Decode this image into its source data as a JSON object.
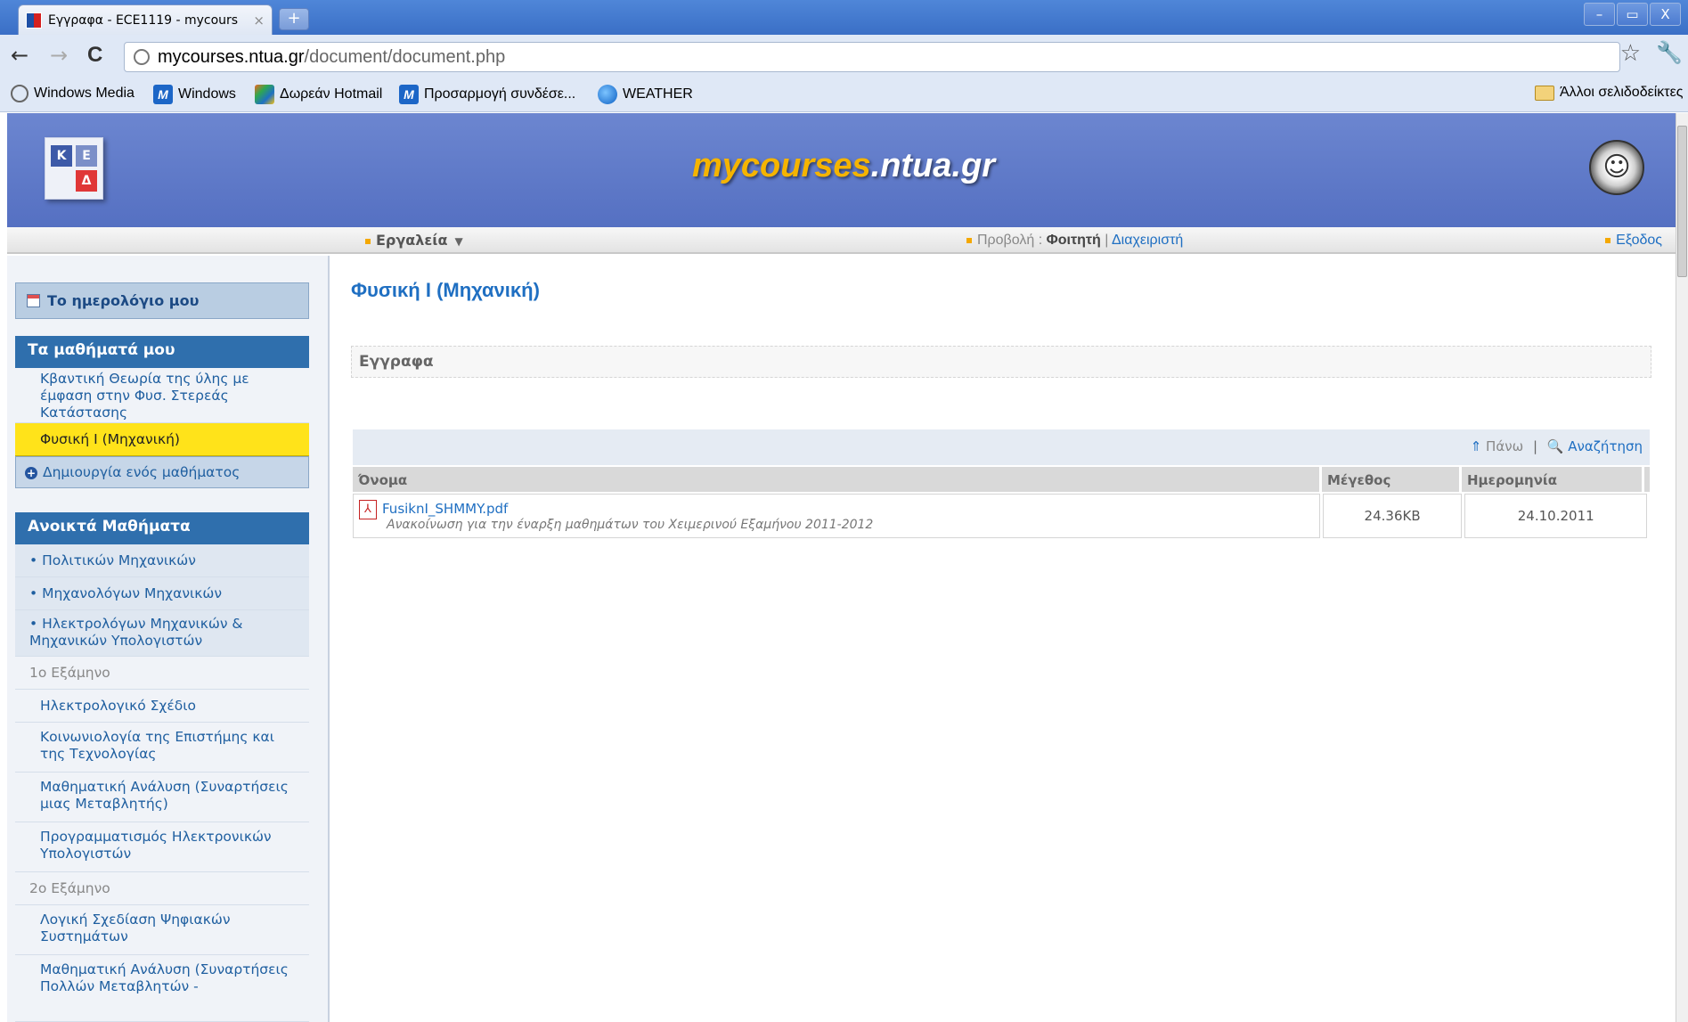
{
  "browser": {
    "tab_title": "Εγγραφα - ECE1119 - mycours",
    "tab_close": "×",
    "new_tab": "+",
    "url_host": "mycourses.ntua.gr",
    "url_path": "/document/document.php",
    "back": "←",
    "forward": "→",
    "reload": "C",
    "star": "☆",
    "wrench": "🔧",
    "window_controls": [
      "–",
      "▭",
      "X"
    ],
    "bookmarks": [
      "Windows Media",
      "Windows",
      "Δωρεάν Hotmail",
      "Προσαρμογή συνδέσε...",
      "WEATHER"
    ],
    "other_bookmarks": "Άλλοι σελιδοδείκτες"
  },
  "site": {
    "name_part1": "mycourses",
    "name_part2": ".ntua.gr",
    "logo_letters": [
      "Κ",
      "Ε",
      "Δ"
    ]
  },
  "menubar": {
    "tools": "Εργαλεία",
    "view_label": "Προβολή : ",
    "view_student": "Φοιτητή",
    "view_sep": " | ",
    "view_admin": "Διαχειριστή",
    "logout": "Εξοδος"
  },
  "sidebar": {
    "calendar": "Το ημερολόγιο μου",
    "my_courses_title": "Τα μαθήματά μου",
    "my_courses": [
      "Κβαντική Θεωρία της ύλης με έμφαση στην Φυσ. Στερεάς Κατάστασης",
      "Φυσική Ι (Μηχανική)"
    ],
    "create_course": "Δημιουργία ενός μαθήματος",
    "open_courses_title": "Ανοικτά Μαθήματα",
    "departments": [
      "• Πολιτικών Μηχανικών",
      "• Μηχανολόγων Μηχανικών",
      "• Ηλεκτρολόγων Μηχανικών & Μηχανικών Υπολογιστών"
    ],
    "semester1": "1ο Εξάμηνο",
    "semester1_courses": [
      "Ηλεκτρολογικό Σχέδιο",
      "Κοινωνιολογία της Επιστήμης και της Τεχνολογίας",
      "Μαθηματική Ανάλυση (Συναρτήσεις μιας Μεταβλητής)",
      "Προγραμματισμός Ηλεκτρονικών Υπολογιστών"
    ],
    "semester2": "2ο Εξάμηνο",
    "semester2_courses": [
      "Λογική Σχεδίαση Ψηφιακών Συστημάτων",
      "Μαθηματική Ανάλυση (Συναρτήσεις Πολλών Μεταβλητών -"
    ]
  },
  "main": {
    "course_title": "Φυσική Ι (Μηχανική)",
    "section_title": "Εγγραφα",
    "up": "Πάνω",
    "search": "Αναζήτηση",
    "columns": [
      "Όνομα",
      "Μέγεθος",
      "Ημερομηνία"
    ],
    "documents": [
      {
        "name": "FusiknI_SHMMY.pdf",
        "description": "Ανακοίνωση για την έναρξη μαθημάτων του Χειμερινού Εξαμήνου 2011-2012",
        "size": "24.36KB",
        "date": "24.10.2011"
      }
    ]
  }
}
